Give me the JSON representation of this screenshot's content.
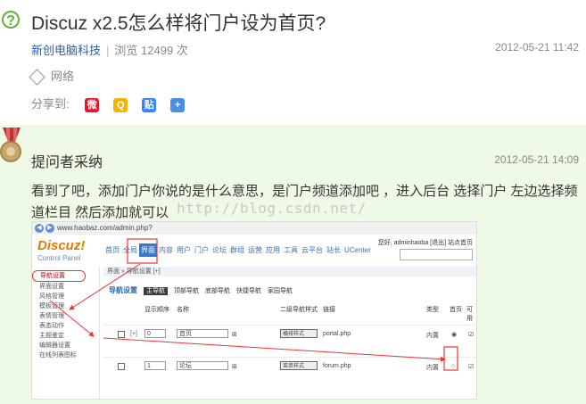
{
  "question": {
    "title": "Discuz x2.5怎么样将门户设为首页?",
    "author": "新创电脑科技",
    "views": "浏览 12499 次",
    "date": "2012-05-21 11:42",
    "tag": "网络",
    "share_label": "分享到:"
  },
  "share_buttons": [
    {
      "name": "weibo",
      "glyph": "微"
    },
    {
      "name": "qzone",
      "glyph": "Q"
    },
    {
      "name": "tieba",
      "glyph": "贴"
    },
    {
      "name": "more",
      "glyph": "+"
    }
  ],
  "answer": {
    "header": "提问者采纳",
    "date": "2012-05-21 14:09",
    "text": "看到了吧，添加门户你说的是什么意思，是门户频道添加吧 ，进入后台 选择门户 左边选择频道栏目 然后添加就可以",
    "watermark": "http://blog.csdn.net/"
  },
  "screenshot": {
    "url": "www.haobaz.com/admin.php?",
    "logo": "Discuz!",
    "logo_sub": "Control Panel",
    "topnav": [
      "首页",
      "全局",
      "界面",
      "内容",
      "用户",
      "门户",
      "论坛",
      "群组",
      "运营",
      "应用",
      "工具",
      "云平台",
      "站长",
      "UCenter"
    ],
    "active_nav": "界面",
    "user": "您好, adminhaoba [退出] 站点首页",
    "breadcrumb": "界面 » 导航设置 [+]",
    "sidebar": [
      "导航设置",
      "界面设置",
      "风格管理",
      "模板管理",
      "表情管理",
      "表态动作",
      "主题鉴定",
      "编辑器设置",
      "在线列表图标"
    ],
    "tabs": [
      "导航设置",
      "主导航",
      "顶部导航",
      "底部导航",
      "快捷导航",
      "家园导航"
    ],
    "active_tab": "主导航",
    "columns": [
      "显示顺序",
      "名称",
      "二级导航样式",
      "链接",
      "类型",
      "首页",
      "可用"
    ],
    "rows": [
      {
        "order": "0",
        "name": "首页",
        "style": "横排样式",
        "link": "portal.php",
        "type": "内置"
      },
      {
        "order": "1",
        "name": "论坛",
        "style": "菜单样式",
        "link": "forum.php",
        "type": "内置"
      }
    ]
  },
  "colors": {
    "accent": "#5fb336",
    "link": "#2a5db0",
    "answer_bg": "#eef9e6"
  }
}
